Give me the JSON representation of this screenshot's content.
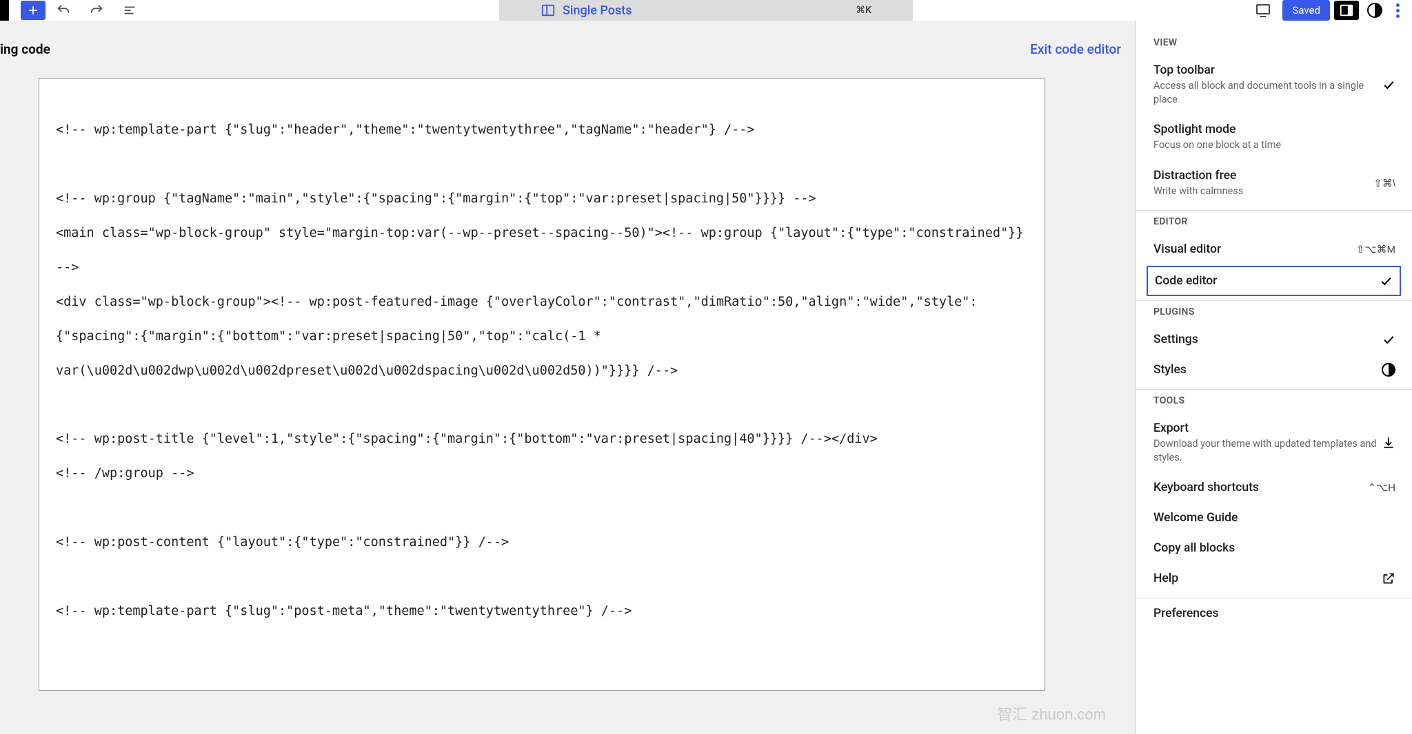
{
  "toolbar": {
    "center_title": "Single Posts",
    "cmd_shortcut": "⌘K",
    "saved_label": "Saved"
  },
  "editor_header": {
    "editing_label": "ing code",
    "exit_label": "Exit code editor"
  },
  "code_content": "<!-- wp:template-part {\"slug\":\"header\",\"theme\":\"twentytwentythree\",\"tagName\":\"header\"} /-->\n\n<!-- wp:group {\"tagName\":\"main\",\"style\":{\"spacing\":{\"margin\":{\"top\":\"var:preset|spacing|50\"}}}} -->\n<main class=\"wp-block-group\" style=\"margin-top:var(--wp--preset--spacing--50)\"><!-- wp:group {\"layout\":{\"type\":\"constrained\"}} -->\n<div class=\"wp-block-group\"><!-- wp:post-featured-image {\"overlayColor\":\"contrast\",\"dimRatio\":50,\"align\":\"wide\",\"style\":{\"spacing\":{\"margin\":{\"bottom\":\"var:preset|spacing|50\",\"top\":\"calc(-1 * var(\\u002d\\u002dwp\\u002d\\u002dpreset\\u002d\\u002dspacing\\u002d\\u002d50))\"}}}} /-->\n\n<!-- wp:post-title {\"level\":1,\"style\":{\"spacing\":{\"margin\":{\"bottom\":\"var:preset|spacing|40\"}}}} /--></div>\n<!-- /wp:group -->\n\n<!-- wp:post-content {\"layout\":{\"type\":\"constrained\"}} /-->\n\n<!-- wp:template-part {\"slug\":\"post-meta\",\"theme\":\"twentytwentythree\"} /-->",
  "sidebar": {
    "sections": {
      "view": {
        "header": "VIEW",
        "items": [
          {
            "title": "Top toolbar",
            "desc": "Access all block and document tools in a single place",
            "right": "check"
          },
          {
            "title": "Spotlight mode",
            "desc": "Focus on one block at a time",
            "right": ""
          },
          {
            "title": "Distraction free",
            "desc": "Write with calmness",
            "right": "⇧⌘\\"
          }
        ]
      },
      "editor": {
        "header": "EDITOR",
        "items": [
          {
            "title": "Visual editor",
            "desc": "",
            "right": "⇧⌥⌘M"
          },
          {
            "title": "Code editor",
            "desc": "",
            "right": "check",
            "selected": true
          }
        ]
      },
      "plugins": {
        "header": "PLUGINS",
        "items": [
          {
            "title": "Settings",
            "desc": "",
            "right": "check"
          },
          {
            "title": "Styles",
            "desc": "",
            "right": "halfcircle"
          }
        ]
      },
      "tools": {
        "header": "TOOLS",
        "items": [
          {
            "title": "Export",
            "desc": "Download your theme with updated templates and styles.",
            "right": "download"
          },
          {
            "title": "Keyboard shortcuts",
            "desc": "",
            "right": "⌃⌥H"
          },
          {
            "title": "Welcome Guide",
            "desc": "",
            "right": ""
          },
          {
            "title": "Copy all blocks",
            "desc": "",
            "right": ""
          },
          {
            "title": "Help",
            "desc": "",
            "right": "external"
          },
          {
            "title": "Preferences",
            "desc": "",
            "right": ""
          }
        ]
      }
    }
  },
  "watermark": "智汇 zhuon.com"
}
